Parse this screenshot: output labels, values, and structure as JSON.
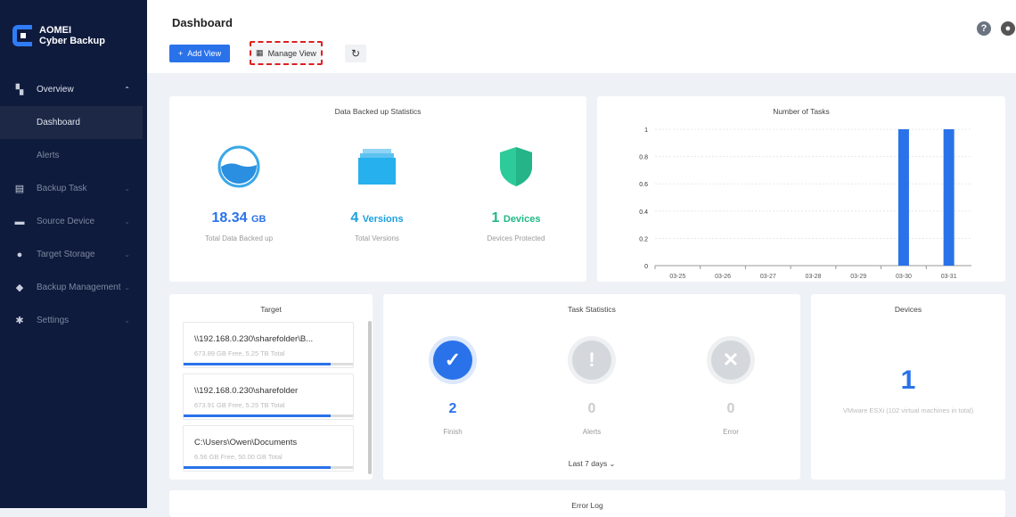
{
  "app": {
    "brand_line1": "AOMEI",
    "brand_line2": "Cyber Backup"
  },
  "sidebar": {
    "items": [
      {
        "label": "Overview",
        "icon": "overview-icon"
      },
      {
        "label": "Dashboard"
      },
      {
        "label": "Alerts"
      },
      {
        "label": "Backup Task",
        "icon": "clipboard-icon"
      },
      {
        "label": "Source Device",
        "icon": "monitor-icon"
      },
      {
        "label": "Target Storage",
        "icon": "location-pin-icon"
      },
      {
        "label": "Backup Management",
        "icon": "layers-icon"
      },
      {
        "label": "Settings",
        "icon": "gear-icon"
      }
    ]
  },
  "header": {
    "title": "Dashboard",
    "add_view": "Add View",
    "manage_view": "Manage View",
    "help": "?"
  },
  "stats": {
    "title": "Data Backed up Statistics",
    "data_value": "18.34",
    "data_unit": "GB",
    "data_label": "Total Data Backed up",
    "versions_value": "4",
    "versions_unit": "Versions",
    "versions_label": "Total Versions",
    "devices_value": "1",
    "devices_unit": "Devices",
    "devices_label": "Devices Protected"
  },
  "chart_data": {
    "type": "bar",
    "title": "Number of Tasks",
    "categories": [
      "03-25",
      "03-26",
      "03-27",
      "03-28",
      "03-29",
      "03-30",
      "03-31"
    ],
    "values": [
      0,
      0,
      0,
      0,
      0,
      1,
      1
    ],
    "ylim": [
      0,
      1
    ],
    "yticks": [
      "0",
      "0.2",
      "0.4",
      "0.6",
      "0.8",
      "1"
    ],
    "color": "#2a72ea"
  },
  "target": {
    "title": "Target",
    "items": [
      {
        "path": "\\\\192.168.0.230\\sharefolder\\B...",
        "space": "673.89 GB Free, 5.25 TB Total",
        "used": 0.87
      },
      {
        "path": "\\\\192.168.0.230\\sharefolder",
        "space": "673.91 GB Free, 5.25 TB Total",
        "used": 0.87
      },
      {
        "path": "C:\\Users\\Owen\\Documents",
        "space": "6.56 GB Free, 50.00 GB Total",
        "used": 0.87
      }
    ]
  },
  "tasks": {
    "title": "Task Statistics",
    "finish": "2",
    "finish_label": "Finish",
    "alerts": "0",
    "alerts_label": "Alerts",
    "error": "0",
    "error_label": "Error",
    "range": "Last 7 days"
  },
  "devices": {
    "title": "Devices",
    "count": "1",
    "desc": "VMware ESXi (102 virtual machines in total)"
  },
  "error_log": {
    "title": "Error Log"
  }
}
